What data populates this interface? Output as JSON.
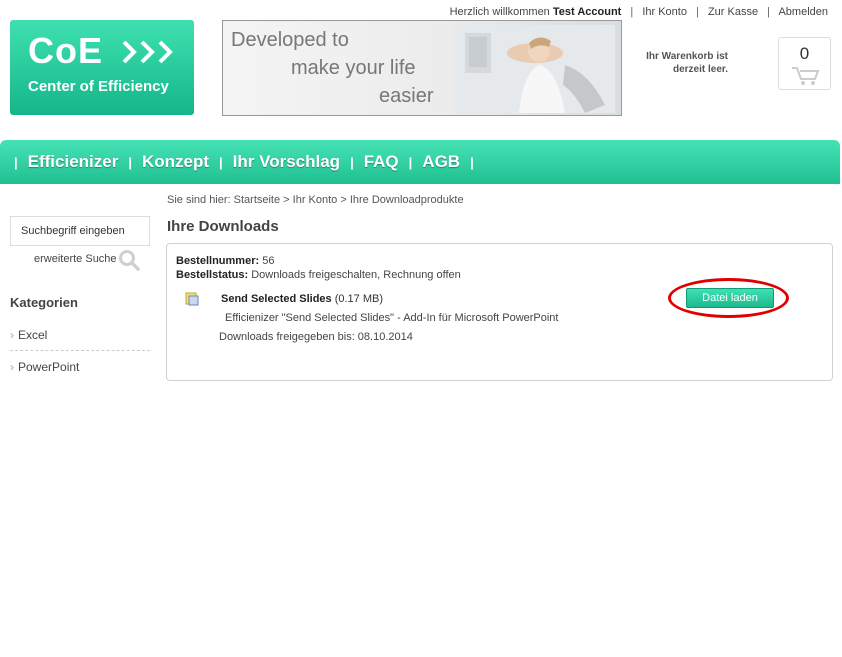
{
  "top_links": {
    "welcome_prefix": "Herzlich willkommen",
    "user_name": "Test Account",
    "my_account": "Ihr Konto",
    "checkout": "Zur Kasse",
    "logout": "Abmelden"
  },
  "logo": {
    "short": "CoE",
    "full": "Center of Efficiency"
  },
  "banner": {
    "line1": "Developed to",
    "line2": "make your life",
    "line3": "easier"
  },
  "cart": {
    "status_line1": "Ihr Warenkorb ist",
    "status_line2": "derzeit leer.",
    "count": "0"
  },
  "nav": {
    "items": [
      {
        "label": "Efficienizer"
      },
      {
        "label": "Konzept"
      },
      {
        "label": "Ihr Vorschlag"
      },
      {
        "label": "FAQ"
      },
      {
        "label": "AGB"
      }
    ]
  },
  "breadcrumb": "Sie sind hier: Startseite > Ihr Konto > Ihre Downloadprodukte",
  "sidebar": {
    "search_placeholder": "Suchbegriff eingeben",
    "advanced_search": "erweiterte Suche",
    "categories_title": "Kategorien",
    "categories": [
      {
        "label": "Excel"
      },
      {
        "label": "PowerPoint"
      }
    ]
  },
  "main": {
    "title": "Ihre Downloads",
    "order": {
      "number_label": "Bestellnummer:",
      "number_value": "56",
      "status_label": "Bestellstatus:",
      "status_value": "Downloads freigeschalten, Rechnung offen"
    },
    "product": {
      "name": "Send Selected Slides",
      "size": "(0.17 MB)",
      "description": "Efficienizer \"Send Selected Slides\" - Add-In für Microsoft PowerPoint",
      "available_until": "Downloads freigegeben bis: 08.10.2014",
      "button_label": "Datei laden"
    }
  },
  "colors": {
    "brand_green": "#20c091",
    "highlight_red": "#e00000"
  }
}
